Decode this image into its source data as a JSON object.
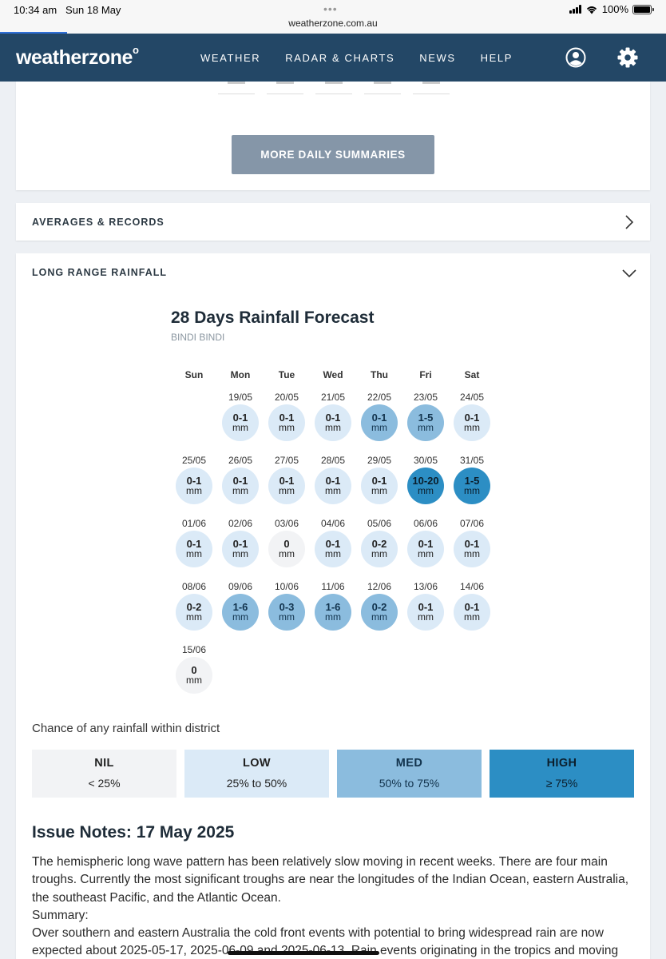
{
  "status_bar": {
    "time": "10:34 am",
    "date": "Sun 18 May",
    "url": "weatherzone.com.au",
    "battery": "100%"
  },
  "nav": {
    "logo": "weatherzone",
    "logo_mark": "o",
    "links": [
      "WEATHER",
      "RADAR & CHARTS",
      "NEWS",
      "HELP"
    ],
    "icons": [
      "account-icon",
      "settings-gear-icon"
    ]
  },
  "daily_summaries": {
    "button_label": "MORE DAILY SUMMARIES"
  },
  "averages": {
    "title": "AVERAGES & RECORDS"
  },
  "long_range": {
    "title": "LONG RANGE RAINFALL",
    "forecast_title": "28 Days Rainfall Forecast",
    "location": "BINDI BINDI",
    "weekdays": [
      "Sun",
      "Mon",
      "Tue",
      "Wed",
      "Thu",
      "Fri",
      "Sat"
    ],
    "unit": "mm",
    "weeks": [
      [
        null,
        {
          "date": "19/05",
          "amount": "0-1",
          "level": "low"
        },
        {
          "date": "20/05",
          "amount": "0-1",
          "level": "low"
        },
        {
          "date": "21/05",
          "amount": "0-1",
          "level": "low"
        },
        {
          "date": "22/05",
          "amount": "0-1",
          "level": "med"
        },
        {
          "date": "23/05",
          "amount": "1-5",
          "level": "med"
        },
        {
          "date": "24/05",
          "amount": "0-1",
          "level": "low"
        }
      ],
      [
        {
          "date": "25/05",
          "amount": "0-1",
          "level": "low"
        },
        {
          "date": "26/05",
          "amount": "0-1",
          "level": "low"
        },
        {
          "date": "27/05",
          "amount": "0-1",
          "level": "low"
        },
        {
          "date": "28/05",
          "amount": "0-1",
          "level": "low"
        },
        {
          "date": "29/05",
          "amount": "0-1",
          "level": "low"
        },
        {
          "date": "30/05",
          "amount": "10-20",
          "level": "high"
        },
        {
          "date": "31/05",
          "amount": "1-5",
          "level": "high"
        }
      ],
      [
        {
          "date": "01/06",
          "amount": "0-1",
          "level": "low"
        },
        {
          "date": "02/06",
          "amount": "0-1",
          "level": "low"
        },
        {
          "date": "03/06",
          "amount": "0",
          "level": "nil"
        },
        {
          "date": "04/06",
          "amount": "0-1",
          "level": "low"
        },
        {
          "date": "05/06",
          "amount": "0-2",
          "level": "low"
        },
        {
          "date": "06/06",
          "amount": "0-1",
          "level": "low"
        },
        {
          "date": "07/06",
          "amount": "0-1",
          "level": "low"
        }
      ],
      [
        {
          "date": "08/06",
          "amount": "0-2",
          "level": "low"
        },
        {
          "date": "09/06",
          "amount": "1-6",
          "level": "med"
        },
        {
          "date": "10/06",
          "amount": "0-3",
          "level": "med"
        },
        {
          "date": "11/06",
          "amount": "1-6",
          "level": "med"
        },
        {
          "date": "12/06",
          "amount": "0-2",
          "level": "med"
        },
        {
          "date": "13/06",
          "amount": "0-1",
          "level": "low"
        },
        {
          "date": "14/06",
          "amount": "0-1",
          "level": "low"
        }
      ],
      [
        {
          "date": "15/06",
          "amount": "0",
          "level": "nil"
        }
      ]
    ],
    "chance_label": "Chance of any rainfall within district",
    "legend": [
      {
        "name": "NIL",
        "range": "< 25%",
        "level": "nil",
        "color": "#f2f3f5"
      },
      {
        "name": "LOW",
        "range": "25% to 50%",
        "level": "low",
        "color": "#dbeaf7"
      },
      {
        "name": "MED",
        "range": "50% to 75%",
        "level": "med",
        "color": "#8bbcde"
      },
      {
        "name": "HIGH",
        "range": "≥ 75%",
        "level": "high",
        "color": "#2c8ec4"
      }
    ]
  },
  "issue_notes": {
    "title": "Issue Notes: 17 May 2025",
    "paragraph": "The hemispheric long wave pattern has been relatively slow moving in recent weeks. There are four main troughs. Currently the most significant troughs are near the longitudes of the Indian Ocean, eastern Australia, the southeast Pacific, and the Atlantic Ocean.",
    "summary_label": "Summary:",
    "summary_text": "Over southern and eastern Australia the cold front events with potential to bring widespread rain are now expected about 2025-05-17, 2025-06-09 and 2025-06-13. Rain events originating in the tropics and moving"
  },
  "colors": {
    "nav_bg": "#234766",
    "button_bg": "#8596a8",
    "page_bg": "#edf0f4"
  }
}
